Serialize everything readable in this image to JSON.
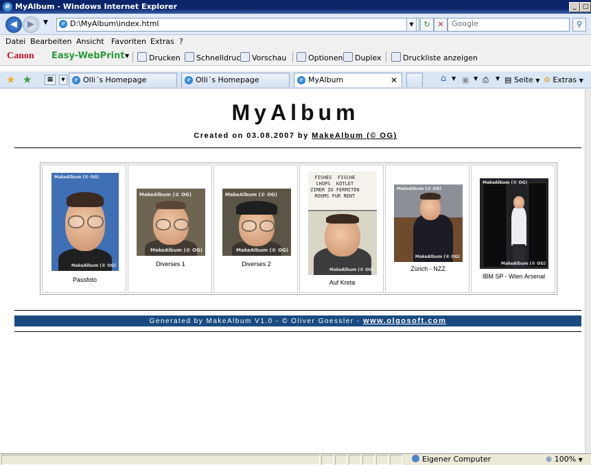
{
  "window": {
    "title": "MyAlbum - Windows Internet Explorer"
  },
  "address": {
    "url": "D:\\MyAlbum\\index.html",
    "search_placeholder": "Google"
  },
  "menu": [
    "Datei",
    "Bearbeiten",
    "Ansicht",
    "Favoriten",
    "Extras",
    "?"
  ],
  "canon": {
    "brand": "Canon",
    "product": "Easy-WebPrint",
    "tools": [
      "Drucken",
      "Schnelldruck",
      "Vorschau",
      "Optionen",
      "Duplex",
      "Druckliste anzeigen"
    ]
  },
  "tabs": [
    {
      "label": "Olli´s Homepage"
    },
    {
      "label": "Olli´s Homepage"
    },
    {
      "label": "MyAlbum"
    }
  ],
  "commands": {
    "page": "Seite",
    "extras": "Extras"
  },
  "page": {
    "title": "MyAlbum",
    "created_prefix": "Created on 03.08.2007 by ",
    "created_link": "MakeAlbum (© OG)",
    "photos": [
      {
        "caption": "Passfoto",
        "watermark": "MakeAlbum (© OG)"
      },
      {
        "caption": "Diverses 1",
        "watermark": "MakeAlbum (© OG)"
      },
      {
        "caption": "Diverses 2",
        "watermark": "MakeAlbum (© OG)"
      },
      {
        "caption": "Auf Kreta",
        "watermark": "MakeAlbum (© OG)",
        "sign_text": "FISHES  FISCHE\nCHOPS  KOTLET\nZIMER ZU FERMITEN\nROOMS FUR RENT"
      },
      {
        "caption": "Zürich - NZZ",
        "watermark": "MakeAlbum (© OG)"
      },
      {
        "caption": "IBM SP - Wien Arsenal",
        "watermark": "MakeAlbum (© OG)"
      }
    ],
    "footer_text": "Generated by MakeAlbum V1.0 - © Oliver Goessler - ",
    "footer_link": "www.olgosoft.com"
  },
  "status": {
    "zone": "Eigener Computer",
    "zoom": "100%"
  },
  "colors": {
    "footer_band": "#1a4a80",
    "titlebar": "#0a246a"
  }
}
